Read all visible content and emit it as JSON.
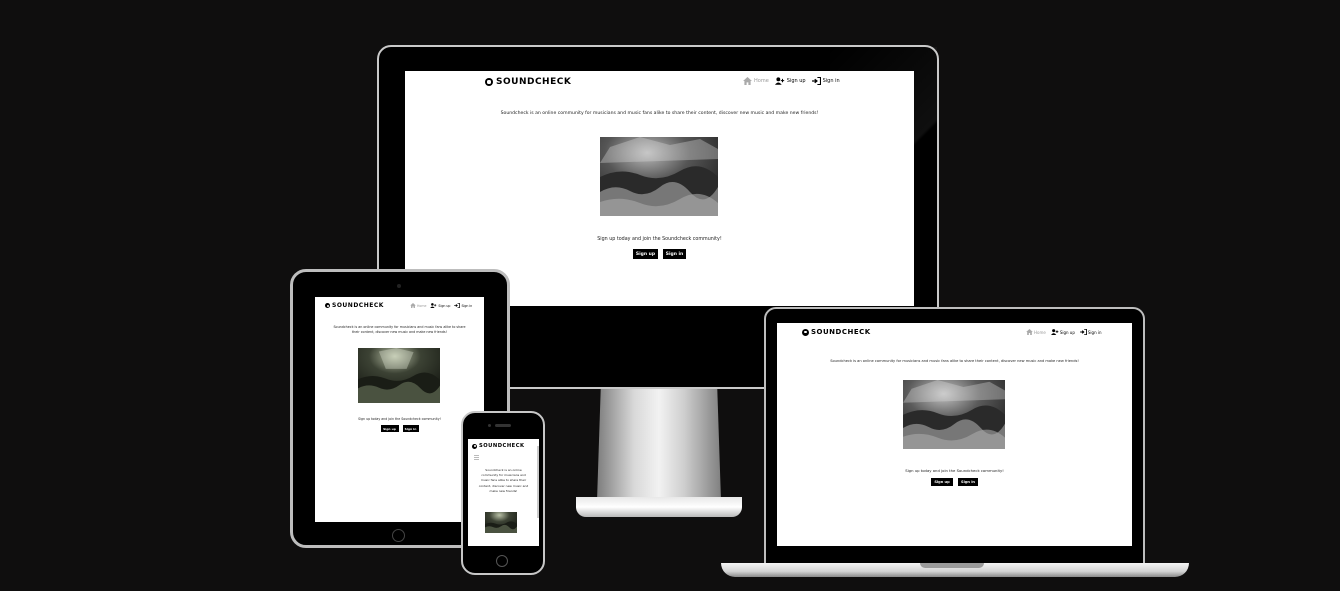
{
  "brand": {
    "logo_text": "SOUNDCHECK"
  },
  "nav": {
    "home": "Home",
    "sign_up": "Sign up",
    "sign_in": "Sign in"
  },
  "hero": {
    "tagline": "Soundcheck is an online community for musicians and music fans alike to share their content, discover new music and make new friends!",
    "cta": "Sign up today and join the Soundcheck community!",
    "sign_up_button": "Sign up",
    "sign_in_button": "Sign in"
  },
  "icons": {
    "home": "home-icon",
    "sign_up": "user-plus-icon",
    "sign_in": "sign-in-icon",
    "logo": "record-icon",
    "menu": "hamburger-icon"
  },
  "colors": {
    "background": "#0f0e0e",
    "screen": "#ffffff",
    "button": "#000000",
    "home_link": "#999999"
  }
}
